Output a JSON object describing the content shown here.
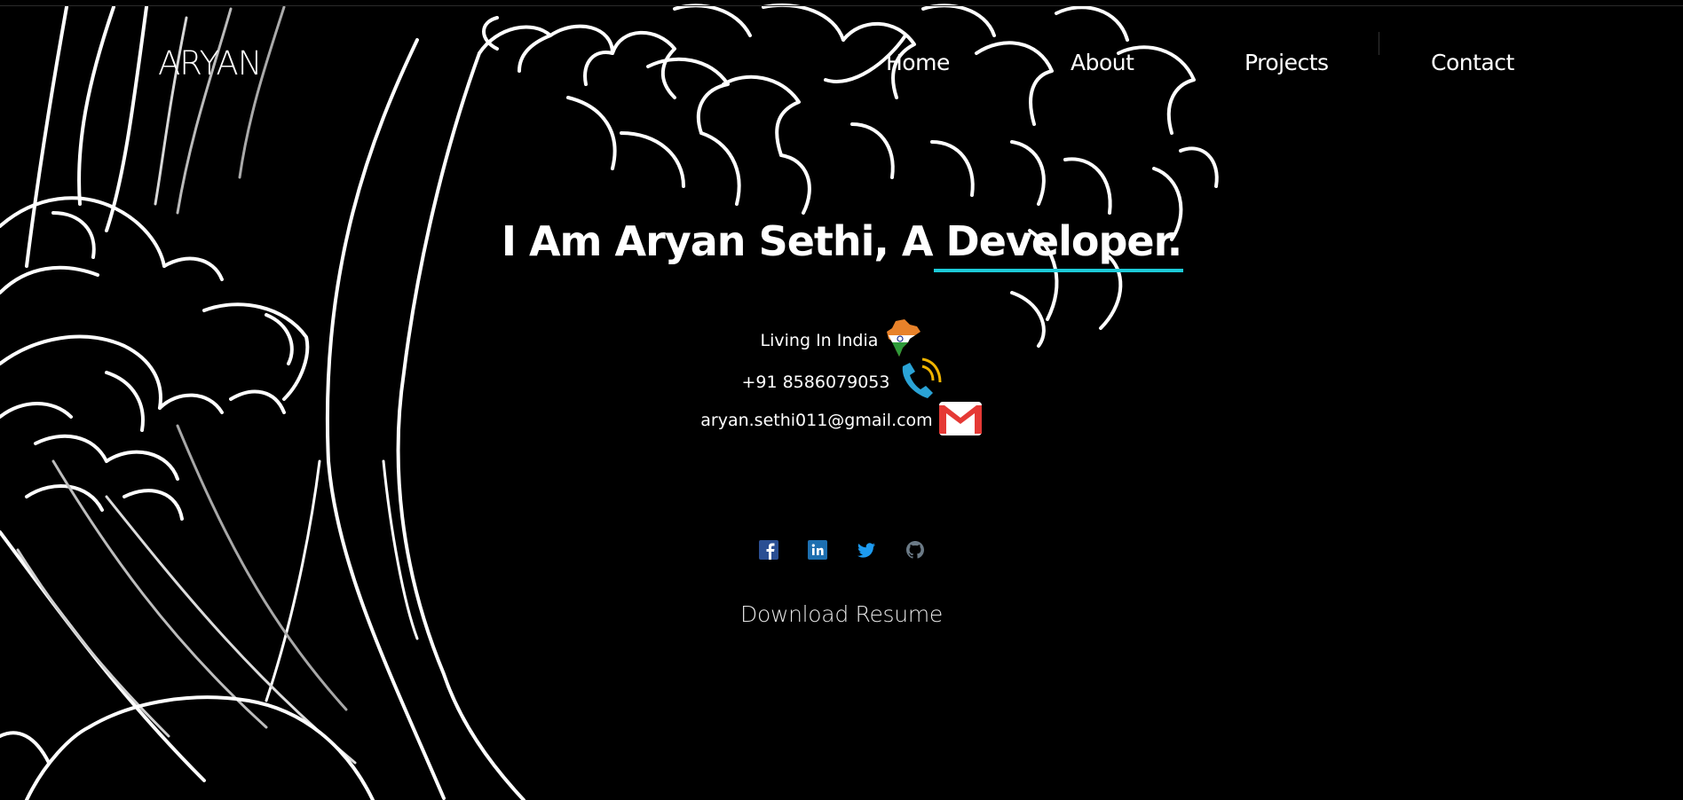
{
  "brand": "ARYAN",
  "nav": {
    "items": [
      {
        "label": "Home"
      },
      {
        "label": "About"
      },
      {
        "label": "Projects"
      },
      {
        "label": "Contact"
      }
    ]
  },
  "hero": {
    "prefix": "I Am Aryan Sethi, A ",
    "typed_word": "Developer."
  },
  "info": {
    "location": "Living In India",
    "phone": "+91 8586079053",
    "email": "aryan.sethi011@gmail.com"
  },
  "socials": [
    {
      "icon": "facebook-icon"
    },
    {
      "icon": "linkedin-icon"
    },
    {
      "icon": "twitter-icon"
    },
    {
      "icon": "github-icon"
    }
  ],
  "resume_label": "Download Resume",
  "colors": {
    "background": "#000000",
    "text": "#ffffff",
    "accent_underline": "#1ccad8"
  }
}
